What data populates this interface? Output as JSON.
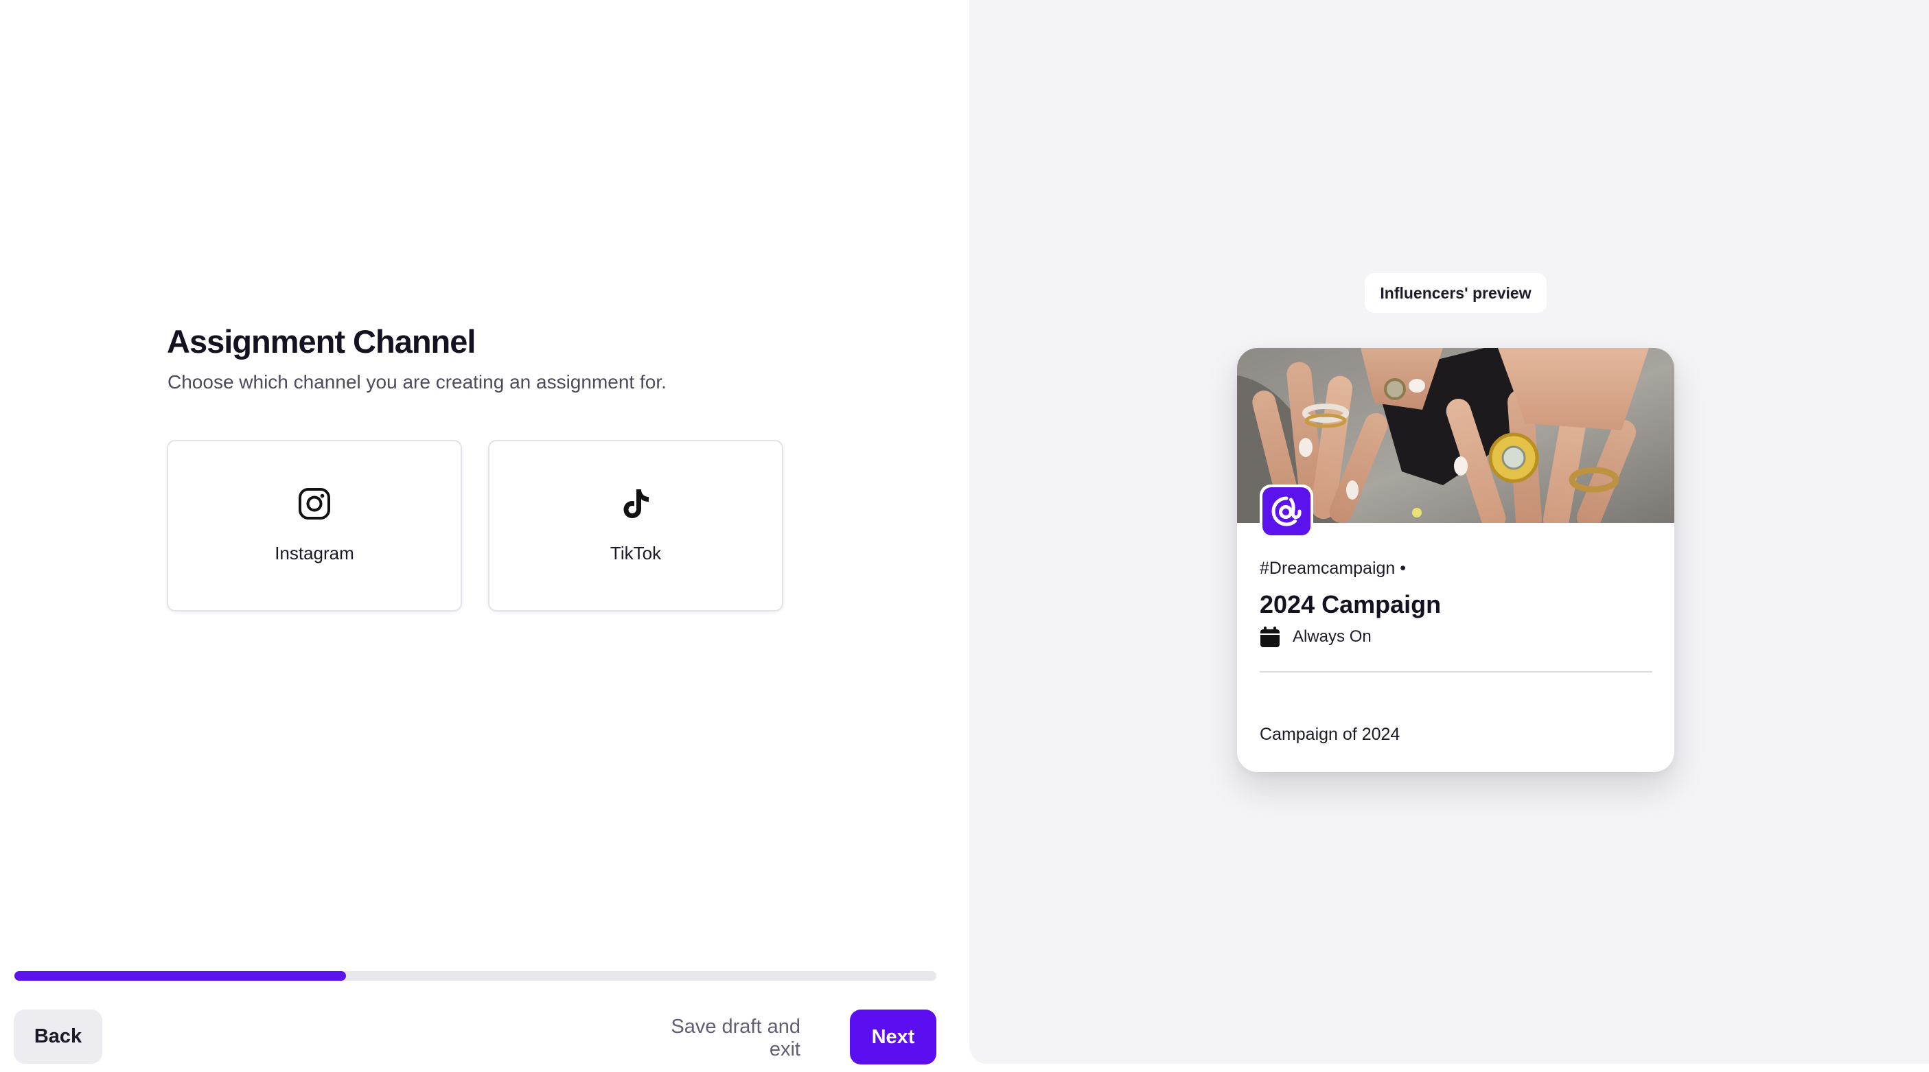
{
  "assignment": {
    "title": "Assignment Channel",
    "subtitle": "Choose which channel you are creating an assignment for."
  },
  "channels": [
    {
      "label": "Instagram",
      "icon": "instagram-icon"
    },
    {
      "label": "TikTok",
      "icon": "tiktok-icon"
    }
  ],
  "progress": {
    "fraction": 0.36,
    "color": "#5b13ec"
  },
  "footer": {
    "back_label": "Back",
    "save_label": "Save draft and exit",
    "next_label": "Next"
  },
  "preview": {
    "badge": "Influencers' preview",
    "hashtag": "#Dreamcampaign •",
    "campaign_title": "2024 Campaign",
    "schedule_icon": "calendar-icon",
    "schedule": "Always On",
    "description": "Campaign of 2024",
    "brand_color": "#5b12ec"
  }
}
